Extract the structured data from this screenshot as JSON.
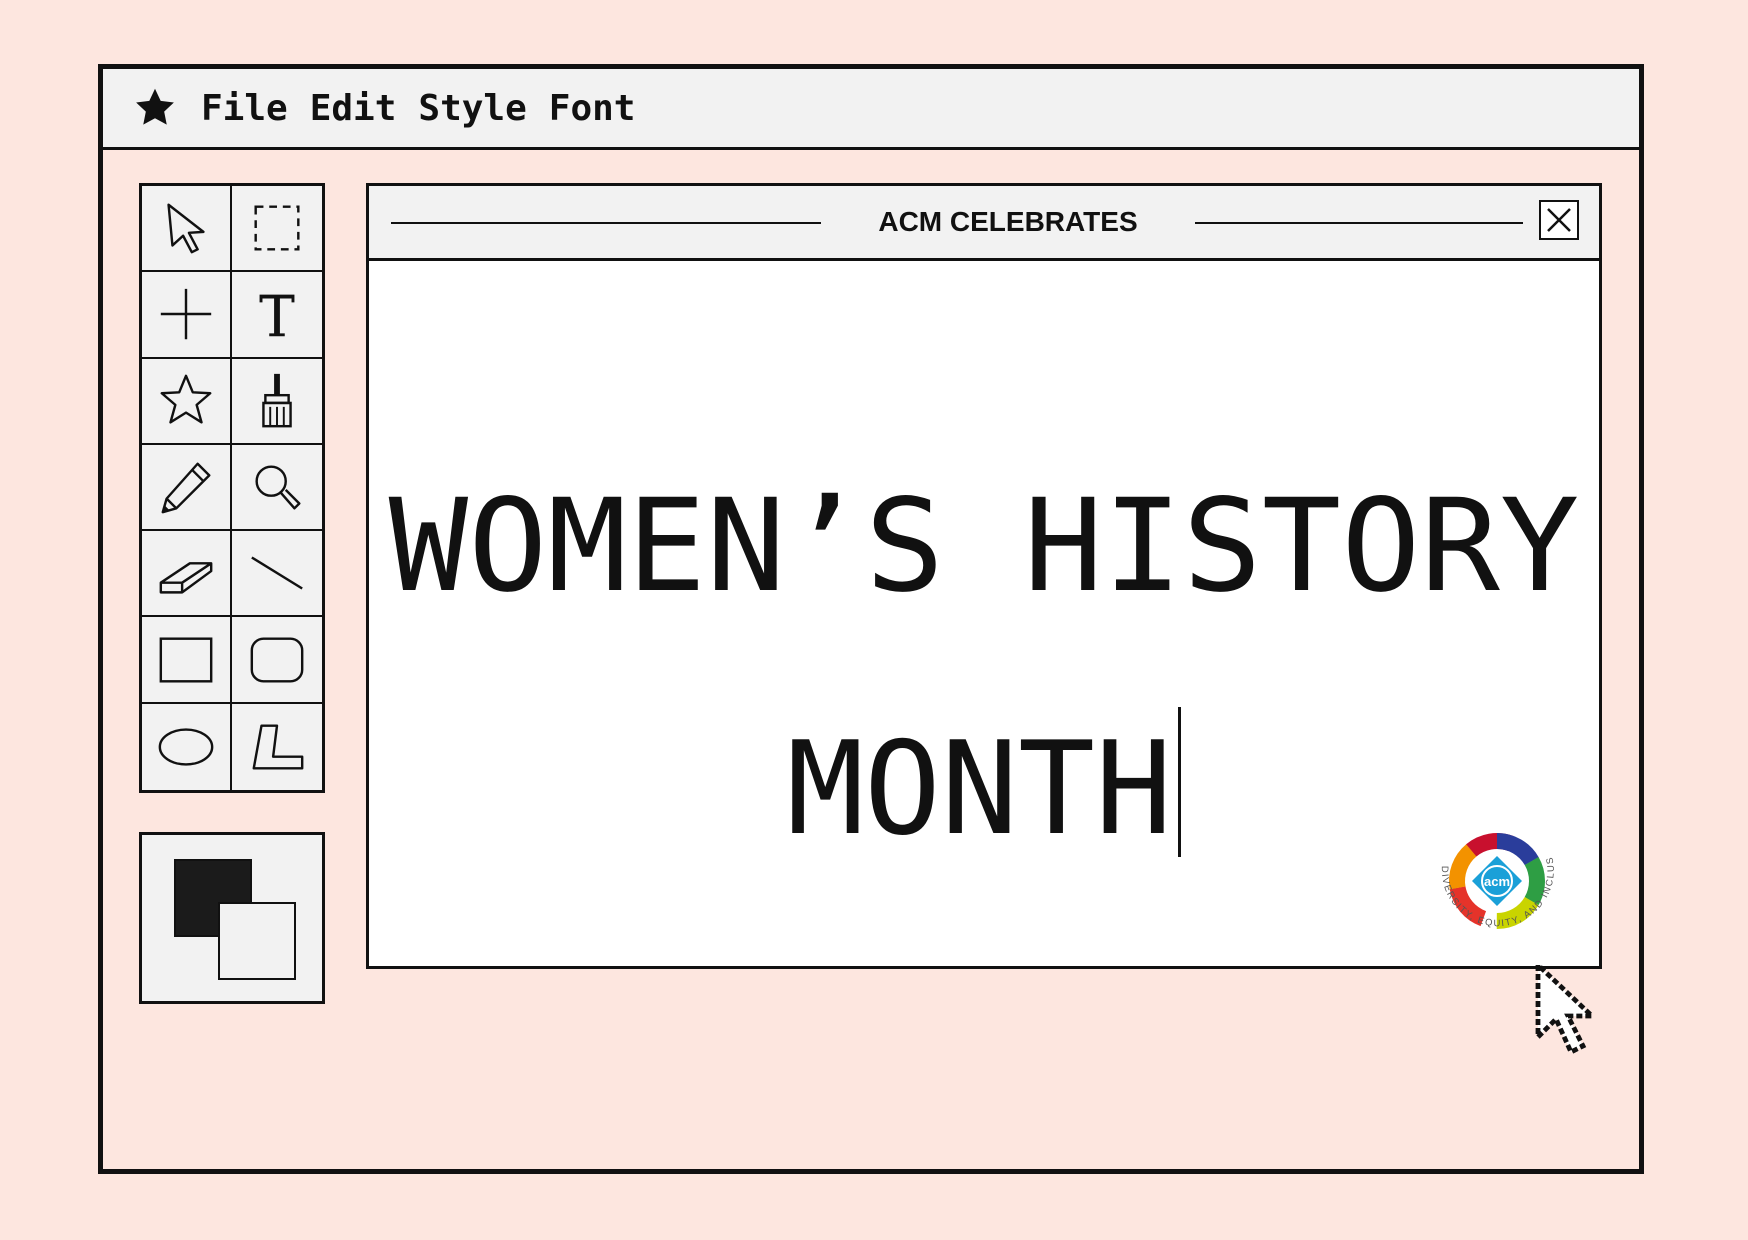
{
  "menubar": {
    "app_icon": "star-icon",
    "items": [
      "File",
      "Edit",
      "Style",
      "Font"
    ]
  },
  "toolbox": {
    "tools": [
      "arrow-select-icon",
      "marquee-select-icon",
      "crosshair-icon",
      "text-tool-icon",
      "star-shape-icon",
      "paint-brush-icon",
      "pencil-icon",
      "magnifier-icon",
      "eraser-icon",
      "line-tool-icon",
      "rectangle-tool-icon",
      "rounded-rectangle-tool-icon",
      "ellipse-tool-icon",
      "polygon-tool-icon"
    ]
  },
  "colors": {
    "foreground": "#1b1b1b",
    "background": "#f2f2f2",
    "page": "#fde6df"
  },
  "document": {
    "title": "ACM CELEBRATES",
    "headline_line1": "WOMEN’S HISTORY",
    "headline_line2": "MONTH",
    "logo_text": "acm",
    "logo_ring_text": "DIVERSITY, EQUITY, AND INCLUSION"
  }
}
